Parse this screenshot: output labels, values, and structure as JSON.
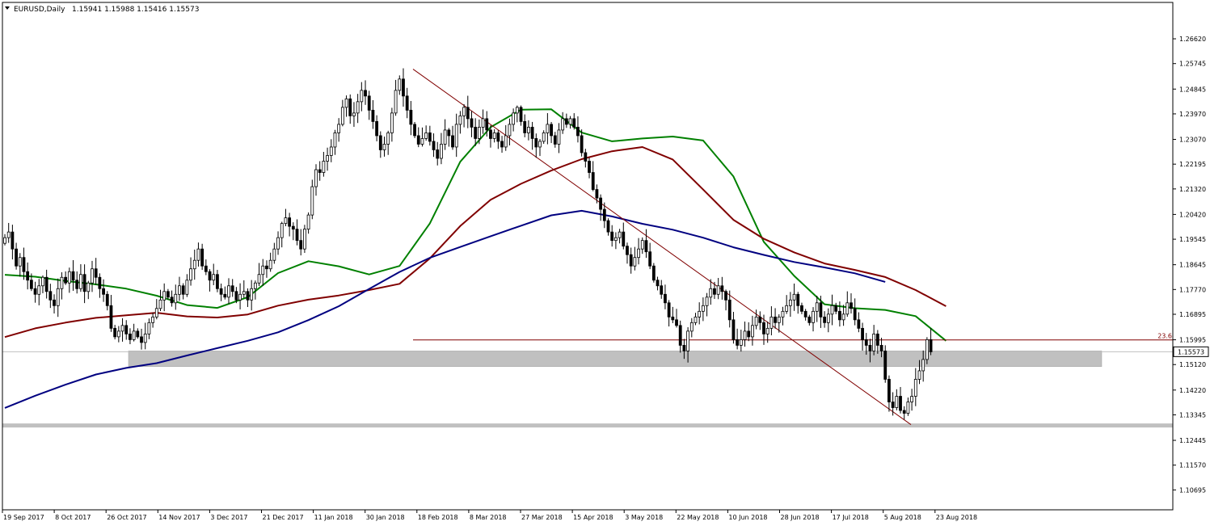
{
  "header": {
    "symbol_timeframe": "EURUSD,Daily",
    "ohlc": "1.15941 1.15988 1.15416 1.15573",
    "collapse_icon": "triangle-down-icon"
  },
  "colors": {
    "background": "#ffffff",
    "frame": "#000000",
    "candle_up_fill": "#ffffff",
    "candle_down_fill": "#000000",
    "candle_outline": "#000000",
    "ma_fast": "#008000",
    "ma_mid": "#800000",
    "ma_slow": "#000080",
    "fib_line": "#800000",
    "trendline": "#800000",
    "zone": "#c0c0c0",
    "bid_line": "#c0c0c0",
    "price_tag_bg": "#ffffff"
  },
  "chart_data": {
    "type": "candlestick",
    "symbol": "EURUSD",
    "timeframe": "Daily",
    "ylim": [
      1.1005,
      1.2702
    ],
    "y_ticks": [
      "1.26620",
      "1.25745",
      "1.24845",
      "1.23970",
      "1.23070",
      "1.22195",
      "1.21320",
      "1.20420",
      "1.19545",
      "1.18645",
      "1.17770",
      "1.16895",
      "1.15995",
      "1.15120",
      "1.14220",
      "1.13345",
      "1.12445",
      "1.11570",
      "1.10695"
    ],
    "x_ticks": [
      "19 Sep 2017",
      "8 Oct 2017",
      "26 Oct 2017",
      "14 Nov 2017",
      "3 Dec 2017",
      "21 Dec 2017",
      "11 Jan 2018",
      "30 Jan 2018",
      "18 Feb 2018",
      "8 Mar 2018",
      "27 Mar 2018",
      "15 Apr 2018",
      "3 May 2018",
      "22 May 2018",
      "10 Jun 2018",
      "28 Jun 2018",
      "17 Jul 2018",
      "5 Aug 2018",
      "23 Aug 2018"
    ],
    "current_price": "1.15573",
    "fib_level_label": "23.6",
    "fib_level_price": 1.1599,
    "support_zone": [
      1.1505,
      1.156
    ],
    "support_line": 1.1297,
    "trendline": {
      "start_price": 1.2555,
      "end_price": 1.13
    },
    "closes": [
      1.196,
      1.198,
      1.192,
      1.186,
      1.189,
      1.184,
      1.181,
      1.178,
      1.176,
      1.179,
      1.182,
      1.177,
      1.174,
      1.172,
      1.178,
      1.182,
      1.18,
      1.184,
      1.181,
      1.178,
      1.183,
      1.177,
      1.18,
      1.185,
      1.182,
      1.178,
      1.176,
      1.172,
      1.164,
      1.161,
      1.163,
      1.165,
      1.162,
      1.16,
      1.163,
      1.161,
      1.159,
      1.162,
      1.166,
      1.168,
      1.171,
      1.174,
      1.177,
      1.175,
      1.173,
      1.176,
      1.179,
      1.176,
      1.181,
      1.185,
      1.188,
      1.192,
      1.186,
      1.184,
      1.181,
      1.183,
      1.178,
      1.176,
      1.175,
      1.179,
      1.177,
      1.174,
      1.176,
      1.177,
      1.174,
      1.178,
      1.18,
      1.183,
      1.186,
      1.185,
      1.188,
      1.192,
      1.196,
      1.201,
      1.203,
      1.2,
      1.199,
      1.195,
      1.192,
      1.199,
      1.204,
      1.214,
      1.22,
      1.219,
      1.223,
      1.225,
      1.228,
      1.233,
      1.236,
      1.242,
      1.245,
      1.239,
      1.24,
      1.244,
      1.248,
      1.246,
      1.241,
      1.237,
      1.232,
      1.227,
      1.229,
      1.233,
      1.24,
      1.248,
      1.252,
      1.246,
      1.241,
      1.236,
      1.232,
      1.229,
      1.231,
      1.233,
      1.23,
      1.227,
      1.224,
      1.229,
      1.234,
      1.232,
      1.228,
      1.236,
      1.239,
      1.242,
      1.238,
      1.235,
      1.231,
      1.235,
      1.238,
      1.234,
      1.231,
      1.233,
      1.23,
      1.228,
      1.232,
      1.236,
      1.24,
      1.242,
      1.237,
      1.233,
      1.235,
      1.231,
      1.228,
      1.23,
      1.233,
      1.236,
      1.232,
      1.229,
      1.234,
      1.238,
      1.236,
      1.238,
      1.235,
      1.232,
      1.226,
      1.223,
      1.219,
      1.213,
      1.21,
      1.206,
      1.202,
      1.198,
      1.195,
      1.196,
      1.198,
      1.193,
      1.19,
      1.186,
      1.189,
      1.192,
      1.195,
      1.191,
      1.186,
      1.181,
      1.179,
      1.176,
      1.173,
      1.168,
      1.167,
      1.165,
      1.158,
      1.156,
      1.163,
      1.166,
      1.168,
      1.17,
      1.172,
      1.175,
      1.178,
      1.176,
      1.179,
      1.177,
      1.174,
      1.167,
      1.16,
      1.158,
      1.16,
      1.163,
      1.161,
      1.165,
      1.168,
      1.166,
      1.162,
      1.164,
      1.168,
      1.166,
      1.168,
      1.17,
      1.172,
      1.174,
      1.176,
      1.172,
      1.17,
      1.168,
      1.166,
      1.17,
      1.173,
      1.168,
      1.166,
      1.169,
      1.172,
      1.17,
      1.167,
      1.169,
      1.173,
      1.171,
      1.167,
      1.164,
      1.16,
      1.158,
      1.156,
      1.162,
      1.158,
      1.156,
      1.146,
      1.138,
      1.136,
      1.14,
      1.135,
      1.134,
      1.138,
      1.14,
      1.146,
      1.149,
      1.153,
      1.16,
      1.1557
    ],
    "series": [
      {
        "name": "",
        "period_days": 20,
        "values": [
          1.1829,
          1.1822,
          1.1807,
          1.1795,
          1.178,
          1.1755,
          1.1722,
          1.1712,
          1.175,
          1.1835,
          1.1877,
          1.1859,
          1.183,
          1.186,
          1.201,
          1.2228,
          1.235,
          1.2412,
          1.2413,
          1.2331,
          1.23,
          1.231,
          1.2317,
          1.2303,
          1.2176,
          1.1945,
          1.1825,
          1.1725,
          1.1711,
          1.1705,
          1.1683,
          1.1596
        ]
      },
      {
        "name": "",
        "period_days": 50,
        "values": [
          1.1609,
          1.164,
          1.166,
          1.1677,
          1.1686,
          1.1695,
          1.1682,
          1.1678,
          1.1689,
          1.172,
          1.1741,
          1.1756,
          1.1775,
          1.1797,
          1.1887,
          1.2001,
          1.2094,
          1.215,
          1.2197,
          1.2237,
          1.2265,
          1.228,
          1.2236,
          1.213,
          1.2023,
          1.1956,
          1.1908,
          1.1869,
          1.1846,
          1.1821,
          1.1775,
          1.1718
        ]
      },
      {
        "name": "",
        "period_days": 200,
        "values": [
          1.1359,
          1.1402,
          1.1441,
          1.1477,
          1.15,
          1.1517,
          1.1544,
          1.157,
          1.1596,
          1.1626,
          1.1669,
          1.1718,
          1.1779,
          1.1839,
          1.1889,
          1.1927,
          1.1965,
          1.2002,
          1.2039,
          1.2055,
          1.2035,
          1.2009,
          1.1988,
          1.196,
          1.1926,
          1.1899,
          1.1874,
          1.1855,
          1.1834,
          1.1804
        ]
      }
    ]
  }
}
